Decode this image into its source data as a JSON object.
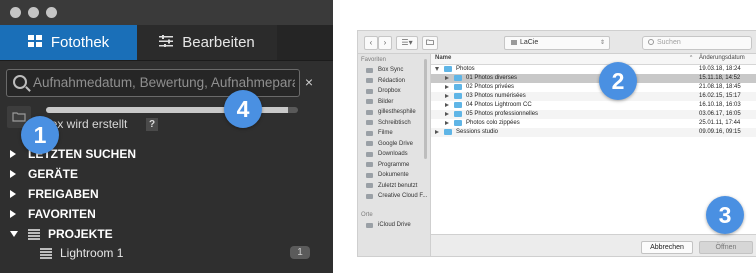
{
  "lightroom": {
    "tabs": {
      "library": "Fotothek",
      "edit": "Bearbeiten"
    },
    "search": {
      "placeholder": "Aufnahmedatum, Bewertung, Aufnahmepara"
    },
    "clear_symbol": "×",
    "indexing": {
      "text": "dex wird erstellt",
      "help": "?",
      "progress": 0.96
    },
    "sections": [
      {
        "label": "LETZTEN SUCHEN"
      },
      {
        "label": "GERÄTE"
      },
      {
        "label": "FREIGABEN"
      },
      {
        "label": "FAVORITEN"
      },
      {
        "label": "PROJEKTE"
      }
    ],
    "project_item": {
      "label": "Lightroom 1",
      "count": "1"
    }
  },
  "dialog": {
    "location": "LaCie",
    "search_placeholder": "Suchen",
    "sidebar": {
      "favorites_header": "Favoriten",
      "favorites": [
        "Box Sync",
        "Rédaction",
        "Dropbox",
        "Bilder",
        "gillesthesphile",
        "Schreibtisch",
        "Filme",
        "Google Drive",
        "Downloads",
        "Programme",
        "Dokumente",
        "Zuletzt benutzt",
        "Creative Cloud F..."
      ],
      "devices_header": "Orte",
      "devices": [
        "iCloud Drive"
      ]
    },
    "columns": {
      "name": "Name",
      "date": "Änderungsdatum"
    },
    "rows": [
      {
        "name": "Photos",
        "date": "19.03.18, 18:24",
        "level": 0,
        "expanded": true
      },
      {
        "name": "01 Photos diverses",
        "date": "15.11.18, 14:52",
        "level": 1,
        "selected": true
      },
      {
        "name": "02 Photos privées",
        "date": "21.08.18, 18:45",
        "level": 1
      },
      {
        "name": "03 Photos numérisées",
        "date": "16.02.15, 15:17",
        "level": 1
      },
      {
        "name": "04 Photos Lightroom CC",
        "date": "16.10.18, 16:03",
        "level": 1
      },
      {
        "name": "05 Photos professionnelles",
        "date": "03.06.17, 16:05",
        "level": 1
      },
      {
        "name": "Photos colo zippées",
        "date": "25.01.11, 17:44",
        "level": 1
      },
      {
        "name": "Sessions studio",
        "date": "09.09.16, 09:15",
        "level": 0
      }
    ],
    "buttons": {
      "cancel": "Abbrechen",
      "open": "Öffnen"
    }
  },
  "callouts": [
    "1",
    "2",
    "3",
    "4"
  ],
  "colors": {
    "accent": "#1a6fb8",
    "callout": "#4a90e2",
    "folder": "#5fb5e6"
  }
}
